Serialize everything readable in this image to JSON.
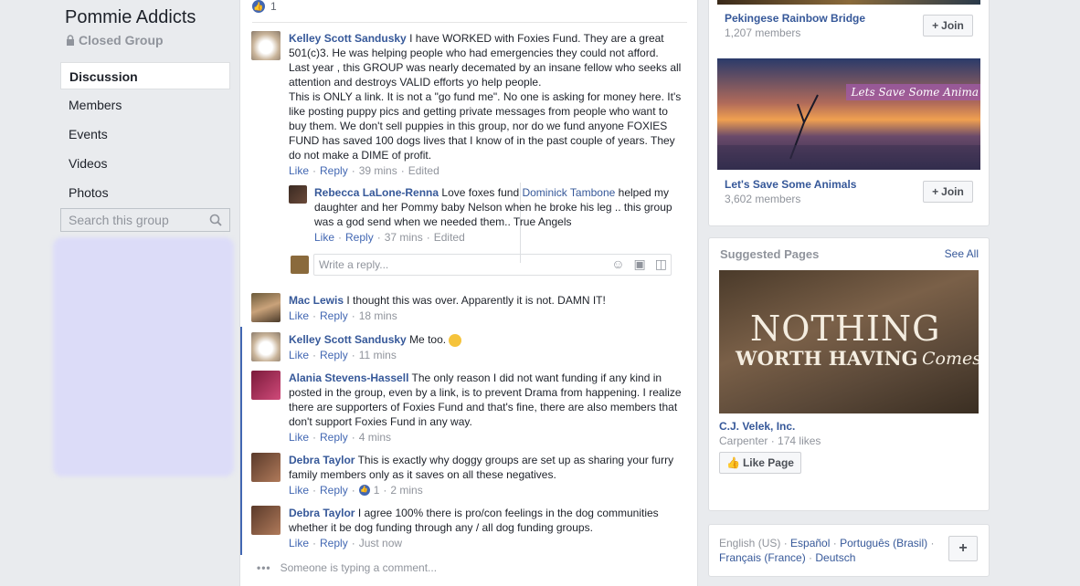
{
  "group": {
    "title": "Pommie Addicts",
    "privacy": "Closed Group",
    "nav": [
      "Discussion",
      "Members",
      "Events",
      "Videos",
      "Photos"
    ],
    "search_placeholder": "Search this group"
  },
  "top_reaction_count": "1",
  "comments": [
    {
      "author": "Kelley Scott Sandusky",
      "text": "I have WORKED with Foxies Fund. They are a great 501(c)3. He was helping people who had emergencies they could not afford. Last year , this GROUP was nearly decemated by an insane fellow who seeks all attention and destroys VALID efforts yo help people.",
      "text2": "This is ONLY a link. It is not a \"go fund me\". No one is asking for money here. It's like posting puppy pics and getting private messages from people who want to buy them. We don't sell puppies in this group, nor do we fund anyone FOXIES FUND has saved 100 dogs lives that I know of in the past couple of years. They do not make a DIME of profit.",
      "like": "Like",
      "reply": "Reply",
      "time": "39 mins",
      "edited": "Edited"
    },
    {
      "author": "Rebecca LaLone-Renna",
      "text_before": "Love foxes fund",
      "mention": "Dominick Tambone",
      "text_after": "helped my daughter and her Pommy baby Nelson when he broke his leg .. this group was a god send when we needed them.. True Angels",
      "like": "Like",
      "reply": "Reply",
      "time": "37 mins",
      "edited": "Edited"
    },
    {
      "author": "Mac Lewis",
      "text": "I thought this was over. Apparently it is not. DAMN IT!",
      "like": "Like",
      "reply": "Reply",
      "time": "18 mins"
    },
    {
      "author": "Kelley Scott Sandusky",
      "text": "Me too.",
      "like": "Like",
      "reply": "Reply",
      "time": "11 mins"
    },
    {
      "author": "Alania Stevens-Hassell",
      "text": "The only reason I did not want funding if any kind in posted in the group, even by a link, is to prevent Drama from happening. I realize there are supporters of Foxies Fund and that's fine, there are also members that don't support Foxies Fund in any way.",
      "like": "Like",
      "reply": "Reply",
      "time": "4 mins"
    },
    {
      "author": "Debra Taylor",
      "text": "This is exactly why doggy groups are set up as sharing your furry family members only as it saves on all these negatives.",
      "like": "Like",
      "reply": "Reply",
      "reactions": "1",
      "time": "2 mins"
    },
    {
      "author": "Debra Taylor",
      "text": "I agree 100% there is pro/con feelings in the dog communities whether it be dog funding through any / all dog funding groups.",
      "like": "Like",
      "reply": "Reply",
      "time": "Just now"
    }
  ],
  "write_reply_placeholder": "Write a reply...",
  "typing_text": "Someone is typing a comment...",
  "suggested_groups": [
    {
      "name": "Pekingese Rainbow Bridge",
      "members": "1,207 members",
      "join": "Join"
    },
    {
      "name": "Let's Save Some Animals",
      "members": "3,602 members",
      "join": "Join",
      "banner_text": "Lets Save Some Anima"
    }
  ],
  "suggested_pages": {
    "heading": "Suggested Pages",
    "see_all": "See All",
    "page_name": "C.J. Velek, Inc.",
    "category": "Carpenter",
    "likes": "174 likes",
    "like_button": "Like Page",
    "image_line1": "NOTHING",
    "image_line2": "WORTH HAVING",
    "image_line3": "Comes"
  },
  "languages": {
    "current": "English (US)",
    "others": [
      "Español",
      "Português (Brasil)",
      "Français (France)",
      "Deutsch"
    ],
    "add": "+"
  }
}
